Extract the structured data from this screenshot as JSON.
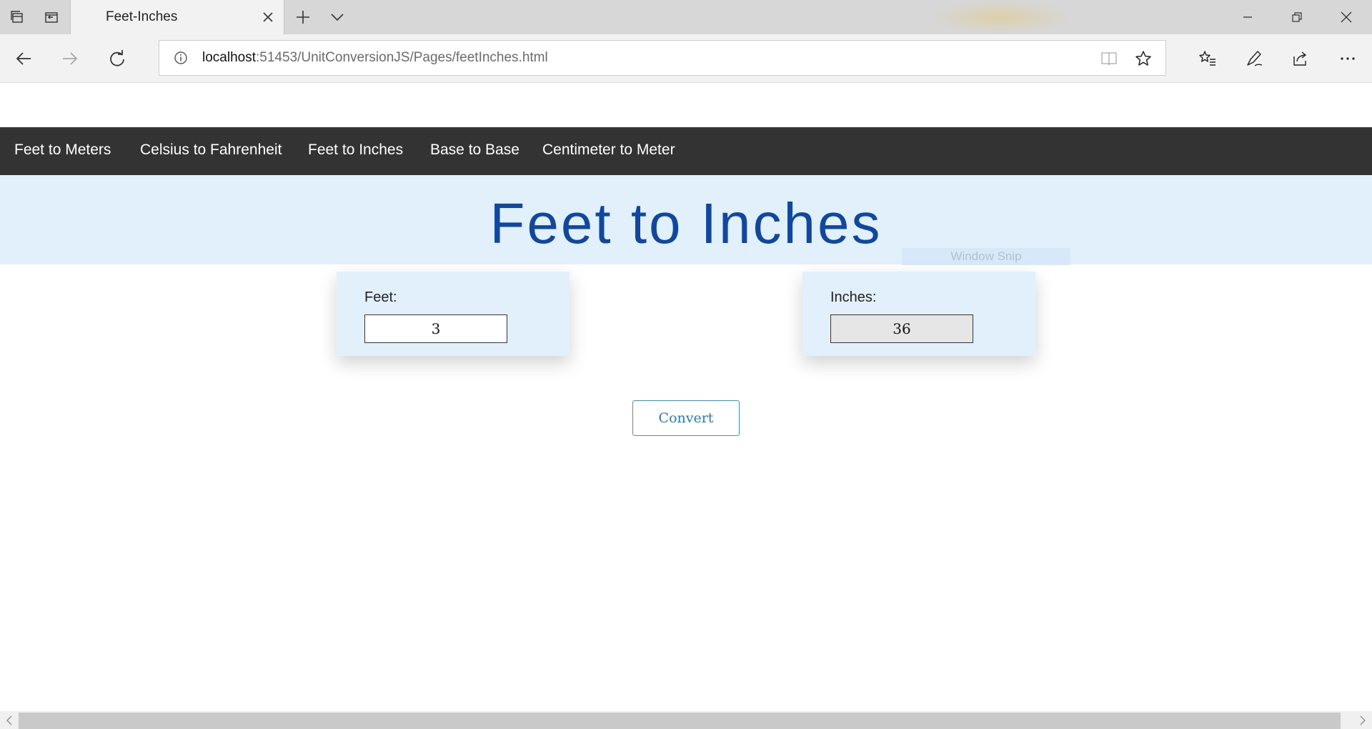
{
  "browser": {
    "tab": {
      "title": "Feet-Inches"
    },
    "address": {
      "host": "localhost",
      "path": ":51453/UnitConversionJS/Pages/feetInches.html"
    },
    "icons": {
      "tab_manager": "tab-manager-icon",
      "set_aside": "set-aside-tabs-icon",
      "new_tab": "plus-icon",
      "tab_list": "chevron-down-icon",
      "minimize": "minimize-icon",
      "restore": "restore-icon",
      "close": "close-icon",
      "back": "back-arrow-icon",
      "forward": "forward-arrow-icon",
      "refresh": "refresh-icon",
      "reading_view": "reading-view-icon",
      "favorite": "star-icon",
      "favorites_hub": "favorites-list-icon",
      "notes": "pen-icon",
      "share": "share-icon",
      "more": "more-icon"
    }
  },
  "site_nav": {
    "items": [
      {
        "label": "Feet to Meters"
      },
      {
        "label": "Celsius to Fahrenheit"
      },
      {
        "label": "Feet to Inches"
      },
      {
        "label": "Base to Base"
      },
      {
        "label": "Centimeter to Meter"
      }
    ]
  },
  "hero": {
    "title": "Feet to Inches"
  },
  "overlay": {
    "ghost_text": "Window Snip"
  },
  "converter": {
    "feet": {
      "label": "Feet:",
      "value": "3"
    },
    "inches": {
      "label": "Inches:",
      "value": "36"
    },
    "button_label": "Convert"
  },
  "colors": {
    "nav_bg": "#333333",
    "hero_bg": "#e2f0fc",
    "title": "#0f47a1",
    "button_text": "#2b79bf"
  }
}
